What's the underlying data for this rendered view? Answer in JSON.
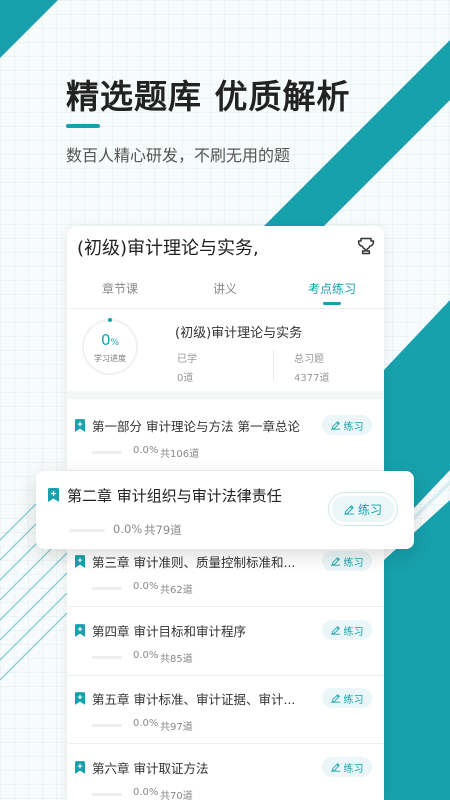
{
  "hero": {
    "title": "精选题库  优质解析",
    "subtitle": "数百人精心研发，不刷无用的题"
  },
  "card": {
    "title": "(初级)审计理论与实务",
    "title_suffix": ",",
    "trophy_icon": "trophy-icon",
    "tabs": [
      {
        "label": "章节课",
        "active": false
      },
      {
        "label": "讲义",
        "active": false
      },
      {
        "label": "考点练习",
        "active": true
      }
    ],
    "summary": {
      "progress_value": "0",
      "progress_unit": "%",
      "progress_fraction": 0,
      "progress_label": "学习进度",
      "book_name": "(初级)审计理论与实务",
      "done_label": "已学",
      "done_value": "0道",
      "total_label": "总习题",
      "total_value": "4377道"
    }
  },
  "chapters": [
    {
      "name": "第一部分 审计理论与方法 第一章总论",
      "percent": "0.0%",
      "count": "共106道",
      "button": "练习"
    },
    {
      "name": "第二章 审计组织与审计法律责任",
      "percent": "0.0%",
      "count": "共79道",
      "button": "练习",
      "highlighted": true
    },
    {
      "name": "第三章 审计准则、质量控制标准和...",
      "percent": "0.0%",
      "count": "共62道",
      "button": "练习"
    },
    {
      "name": "第四章 审计目标和审计程序",
      "percent": "0.0%",
      "count": "共85道",
      "button": "练习"
    },
    {
      "name": "第五章 审计标准、审计证据、审计...",
      "percent": "0.0%",
      "count": "共97道",
      "button": "练习"
    },
    {
      "name": "第六章 审计取证方法",
      "percent": "0.0%",
      "count": "共70道",
      "button": "练习"
    }
  ],
  "colors": {
    "accent": "#17a1ac",
    "accent_light": "#eaf6f7"
  }
}
